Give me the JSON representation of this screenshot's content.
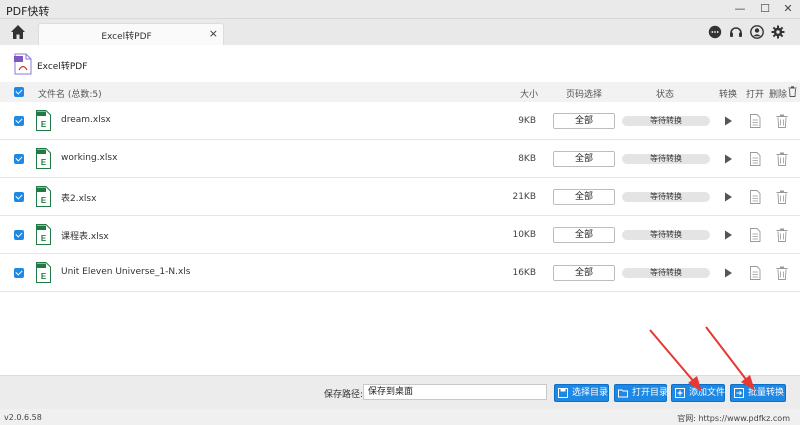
{
  "window": {
    "title": "PDF快转",
    "minimize": "—",
    "maximize": "☐",
    "close": "✕"
  },
  "tab": {
    "label": "Excel转PDF",
    "close": "×"
  },
  "page": {
    "title": "Excel转PDF"
  },
  "table": {
    "headers": {
      "name": "文件名 (总数:5)",
      "size": "大小",
      "page_select": "页码选择",
      "status": "状态",
      "convert": "转换",
      "open": "打开",
      "delete": "删除"
    },
    "rows": [
      {
        "name": "dream.xlsx",
        "size": "9KB",
        "pages": "全部",
        "status": "等待转换",
        "checked": true
      },
      {
        "name": "working.xlsx",
        "size": "8KB",
        "pages": "全部",
        "status": "等待转换",
        "checked": true
      },
      {
        "name": "表2.xlsx",
        "size": "21KB",
        "pages": "全部",
        "status": "等待转换",
        "checked": true
      },
      {
        "name": "课程表.xlsx",
        "size": "10KB",
        "pages": "全部",
        "status": "等待转换",
        "checked": true
      },
      {
        "name": "Unit Eleven Universe_1-N.xls",
        "size": "16KB",
        "pages": "全部",
        "status": "等待转换",
        "checked": true
      }
    ]
  },
  "bottom": {
    "save_label": "保存路径:",
    "save_value": "保存到桌面",
    "choose_dir": "选择目录",
    "open_dir": "打开目录",
    "add_file": "添加文件",
    "batch_convert": "批量转换"
  },
  "statusbar": {
    "version": "v2.0.6.58",
    "site": "官网: https://www.pdfkz.com"
  },
  "icons": [
    "home-icon",
    "chat-icon",
    "headset-icon",
    "user-icon",
    "settings-icon",
    "play-icon",
    "document-icon",
    "trash-icon",
    "excel-file-icon",
    "pdf-file-icon"
  ],
  "colors": {
    "accent": "#1e88e5",
    "annotation_arrow": "#e53935",
    "excel_green": "#1f7a43"
  }
}
